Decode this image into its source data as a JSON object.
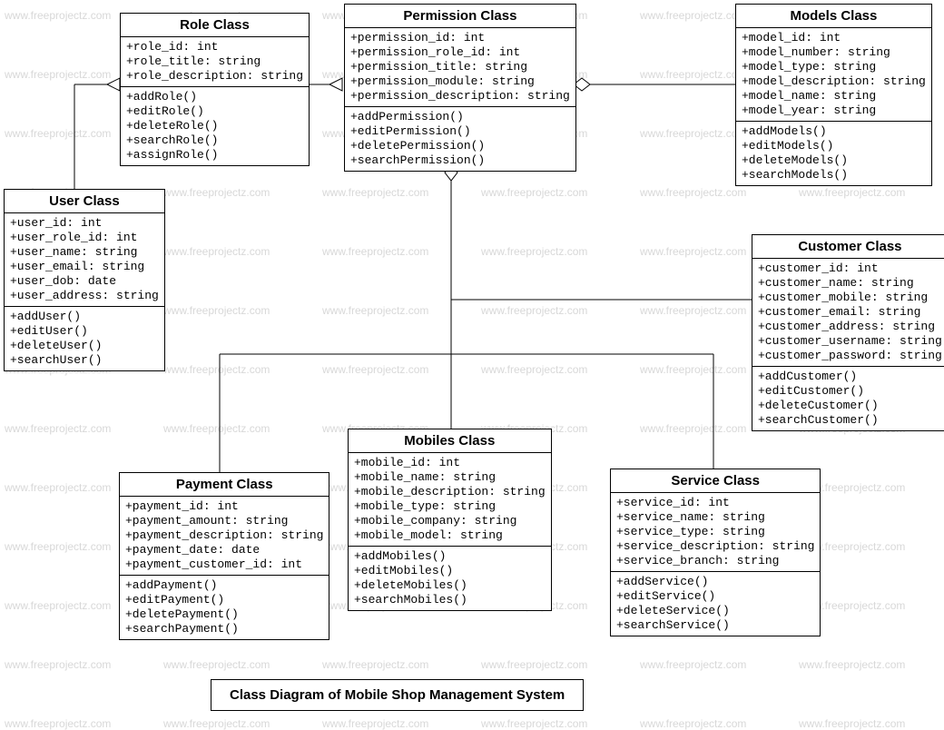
{
  "watermark": "www.freeprojectz.com",
  "title": "Class Diagram of Mobile Shop Management System",
  "classes": {
    "role": {
      "name": "Role Class",
      "attributes": [
        "+role_id: int",
        "+role_title: string",
        "+role_description: string"
      ],
      "methods": [
        "+addRole()",
        "+editRole()",
        "+deleteRole()",
        "+searchRole()",
        "+assignRole()"
      ]
    },
    "permission": {
      "name": "Permission Class",
      "attributes": [
        "+permission_id: int",
        "+permission_role_id: int",
        "+permission_title: string",
        "+permission_module: string",
        "+permission_description: string"
      ],
      "methods": [
        "+addPermission()",
        "+editPermission()",
        "+deletePermission()",
        "+searchPermission()"
      ]
    },
    "models": {
      "name": "Models Class",
      "attributes": [
        "+model_id: int",
        "+model_number: string",
        "+model_type: string",
        "+model_description: string",
        "+model_name: string",
        "+model_year: string"
      ],
      "methods": [
        "+addModels()",
        "+editModels()",
        "+deleteModels()",
        "+searchModels()"
      ]
    },
    "user": {
      "name": "User Class",
      "attributes": [
        "+user_id: int",
        "+user_role_id: int",
        "+user_name: string",
        "+user_email: string",
        "+user_dob: date",
        "+user_address: string"
      ],
      "methods": [
        "+addUser()",
        "+editUser()",
        "+deleteUser()",
        "+searchUser()"
      ]
    },
    "customer": {
      "name": "Customer Class",
      "attributes": [
        "+customer_id: int",
        "+customer_name: string",
        "+customer_mobile: string",
        "+customer_email: string",
        "+customer_address: string",
        "+customer_username: string",
        "+customer_password: string"
      ],
      "methods": [
        "+addCustomer()",
        "+editCustomer()",
        "+deleteCustomer()",
        "+searchCustomer()"
      ]
    },
    "payment": {
      "name": "Payment Class",
      "attributes": [
        "+payment_id: int",
        "+payment_amount: string",
        "+payment_description: string",
        "+payment_date: date",
        "+payment_customer_id: int"
      ],
      "methods": [
        "+addPayment()",
        "+editPayment()",
        "+deletePayment()",
        "+searchPayment()"
      ]
    },
    "mobiles": {
      "name": "Mobiles  Class",
      "attributes": [
        "+mobile_id: int",
        "+mobile_name: string",
        "+mobile_description: string",
        "+mobile_type: string",
        "+mobile_company: string",
        "+mobile_model: string"
      ],
      "methods": [
        "+addMobiles()",
        "+editMobiles()",
        "+deleteMobiles()",
        "+searchMobiles()"
      ]
    },
    "service": {
      "name": "Service Class",
      "attributes": [
        "+service_id: int",
        "+service_name: string",
        "+service_type: string",
        "+service_description: string",
        "+service_branch: string"
      ],
      "methods": [
        "+addService()",
        "+editService()",
        "+deleteService()",
        "+searchService()"
      ]
    }
  }
}
